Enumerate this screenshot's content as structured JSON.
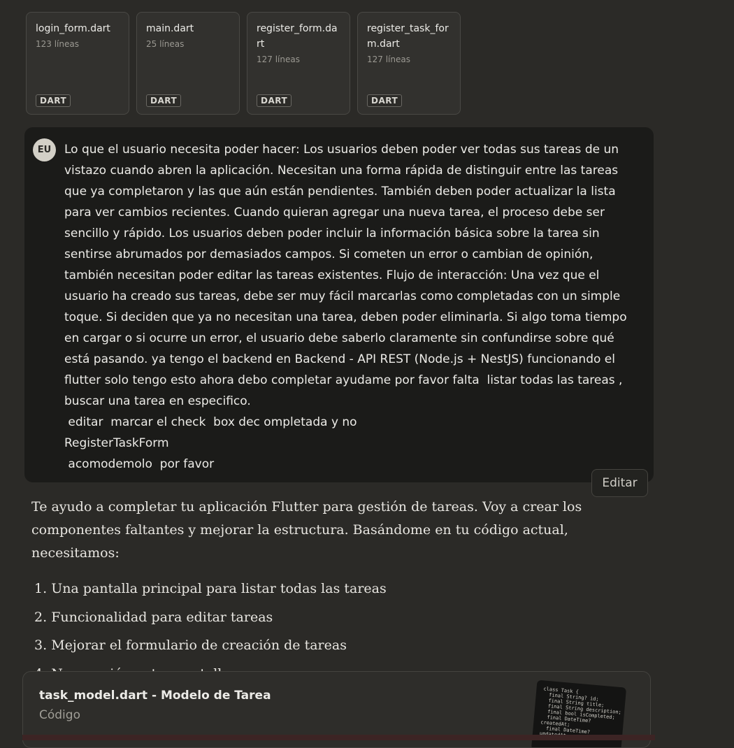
{
  "files": [
    {
      "name": "login_form.dart",
      "lines": "123 líneas",
      "badge": "DART"
    },
    {
      "name": "main.dart",
      "lines": "25 líneas",
      "badge": "DART"
    },
    {
      "name": "register_form.dart",
      "lines": "127 líneas",
      "badge": "DART"
    },
    {
      "name": "register_task_form.dart",
      "lines": "127 líneas",
      "badge": "DART"
    }
  ],
  "user_message": {
    "avatar": "EU",
    "text": "Lo que el usuario necesita poder hacer: Los usuarios deben poder ver todas sus tareas de un vistazo cuando abren la aplicación. Necesitan una forma rápida de distinguir entre las tareas que ya completaron y las que aún están pendientes. También deben poder actualizar la lista para ver cambios recientes. Cuando quieran agregar una nueva tarea, el proceso debe ser sencillo y rápido. Los usuarios deben poder incluir la información básica sobre la tarea sin sentirse abrumados por demasiados campos. Si cometen un error o cambian de opinión, también necesitan poder editar las tareas existentes. Flujo de interacción: Una vez que el usuario ha creado sus tareas, debe ser muy fácil marcarlas como completadas con un simple toque. Si deciden que ya no necesitan una tarea, deben poder eliminarla. Si algo toma tiempo en cargar o si ocurre un error, el usuario debe saberlo claramente sin confundirse sobre qué está pasando. ya tengo el backend en Backend - API REST (Node.js + NestJS) funcionando el flutter solo tengo esto ahora debo completar ayudame por favor falta  listar todas las tareas , buscar una tarea en especifico.\n editar  marcar el check  box dec ompletada y no\nRegisterTaskForm\n acomodemolo  por favor",
    "edit_label": "Editar"
  },
  "assistant": {
    "intro": "Te ayudo a completar tu aplicación Flutter para gestión de tareas. Voy a crear los componentes faltantes y mejorar la estructura. Basándome en tu código actual, necesitamos:",
    "steps": [
      {
        "num": "1.",
        "text": "Una pantalla principal para listar todas las tareas"
      },
      {
        "num": "2.",
        "text": "Funcionalidad para editar tareas"
      },
      {
        "num": "3.",
        "text": "Mejorar el formulario de creación de tareas"
      },
      {
        "num": "4.",
        "text": "Navegación entre pantallas"
      }
    ]
  },
  "artifact": {
    "title": "task_model.dart - Modelo de Tarea",
    "subtitle": "Código",
    "preview_code": "class Task {\n  final String? id;\n  final String title;\n  final String description;\n  final bool isCompleted;\n  final DateTime?\ncreatedAt;\n  final DateTime?\nupdatedAt;"
  }
}
